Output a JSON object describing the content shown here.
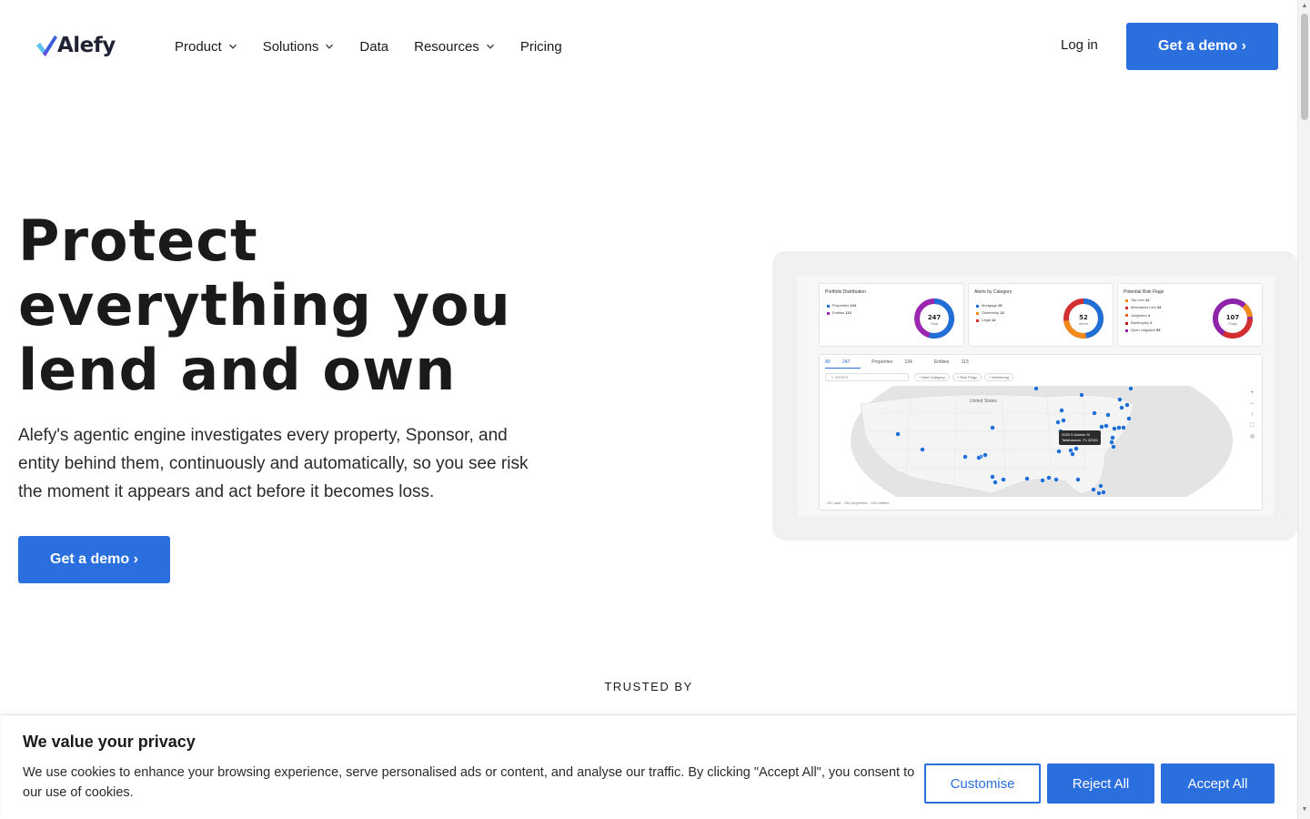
{
  "brand": {
    "name": "Alefy",
    "accent": "#2b6fdf"
  },
  "nav": {
    "items": [
      {
        "label": "Product",
        "has_dropdown": true
      },
      {
        "label": "Solutions",
        "has_dropdown": true
      },
      {
        "label": "Data",
        "has_dropdown": false
      },
      {
        "label": "Resources",
        "has_dropdown": true
      },
      {
        "label": "Pricing",
        "has_dropdown": false
      }
    ],
    "login_label": "Log in",
    "cta_label": "Get a demo ›"
  },
  "hero": {
    "title_lines": [
      "Protect",
      "everything you",
      "lend and own"
    ],
    "subtitle": "Alefy's agentic engine investigates every property, Sponsor, and entity behind them, continuously and automatically, so you see risk the moment it appears and act before it becomes loss.",
    "cta_label": "Get a demo ›"
  },
  "preview": {
    "cards": [
      {
        "title": "Portfolio Distribution",
        "legend": [
          {
            "label": "Properties",
            "value": "134",
            "color": "#1f6fd6"
          },
          {
            "label": "Entities",
            "value": "113",
            "color": "#9b27b0"
          }
        ],
        "total": "247",
        "total_label": "Total"
      },
      {
        "title": "Alerts by Category",
        "legend": [
          {
            "label": "Mortgage",
            "value": "25",
            "color": "#1f6fd6"
          },
          {
            "label": "Ownership",
            "value": "13",
            "color": "#ef8a1b"
          },
          {
            "label": "Legal",
            "value": "14",
            "color": "#d32f2f"
          }
        ],
        "total": "52",
        "total_label": "Alerts"
      },
      {
        "title": "Potential Risk Flags",
        "legend": [
          {
            "label": "Tax Lien",
            "value": "12",
            "color": "#ef8a1b"
          },
          {
            "label": "Mechanics Lien",
            "value": "34",
            "color": "#d32f2f"
          },
          {
            "label": "Judgment",
            "value": "4",
            "color": "#e0632a"
          },
          {
            "label": "Bankruptcy",
            "value": "2",
            "color": "#b71c1c"
          },
          {
            "label": "Open Litigation",
            "value": "55",
            "color": "#8e24aa"
          }
        ],
        "total": "107",
        "total_label": "Flags"
      }
    ],
    "tabs": [
      {
        "label": "All",
        "count": "247"
      },
      {
        "label": "Properties",
        "count": "134"
      },
      {
        "label": "Entities",
        "count": "113"
      }
    ],
    "search_placeholder": "Search",
    "chips": [
      "+ Alert Category",
      "+ Risk Flags",
      "+ Monitoring"
    ],
    "map_label": "United States",
    "tooltip_line1": "2025 S Adams St",
    "tooltip_line2": "Tallahassee, FL 32301",
    "footer": "247 total · 134 properties · 113 entities"
  },
  "trusted": {
    "label": "TRUSTED BY"
  },
  "cookie": {
    "title": "We value your privacy",
    "text": "We use cookies to enhance your browsing experience, serve personalised ads or content, and analyse our traffic. By clicking \"Accept All\", you consent to our use of cookies.",
    "customise_label": "Customise",
    "reject_label": "Reject All",
    "accept_label": "Accept All"
  }
}
